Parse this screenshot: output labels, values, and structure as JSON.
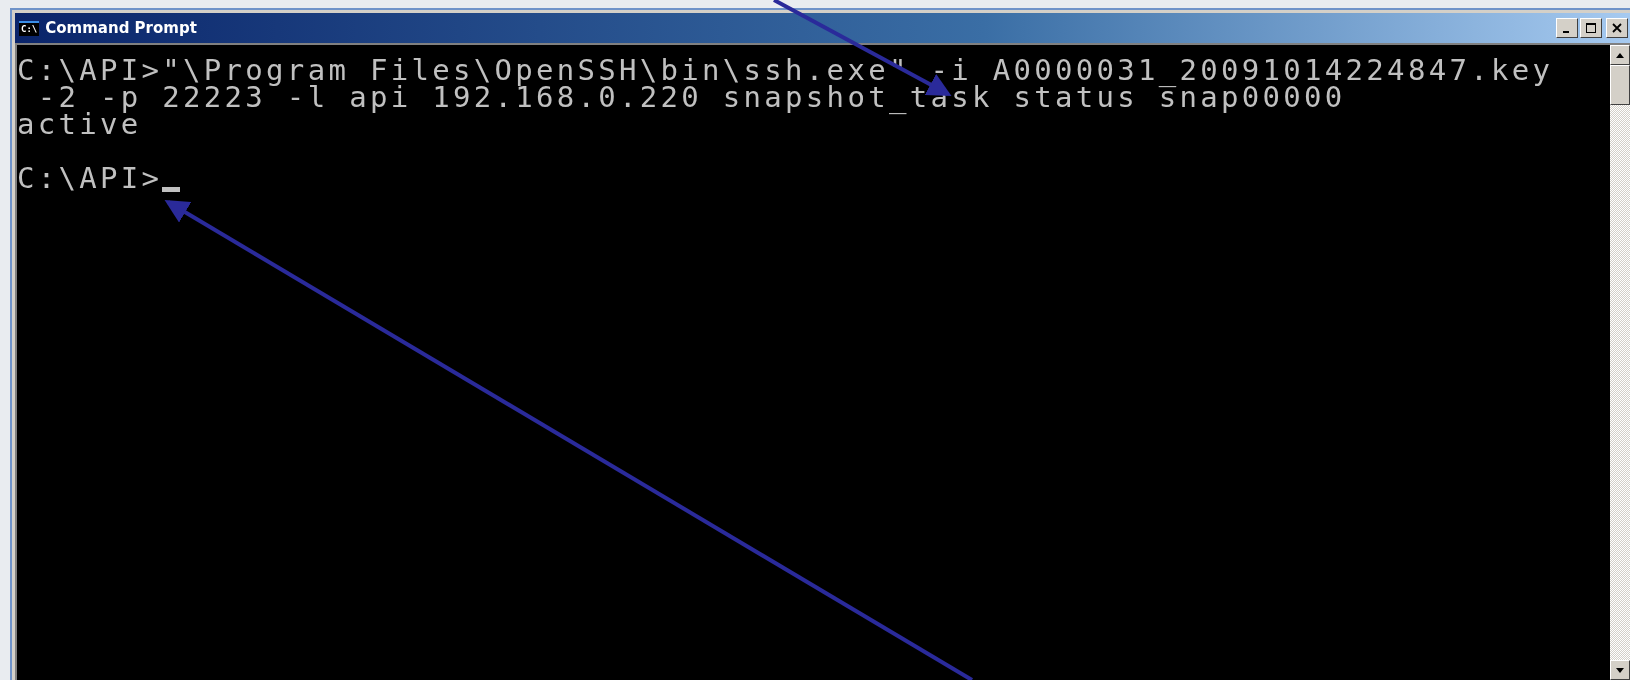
{
  "window": {
    "title": "Command Prompt",
    "icon_text": "C:\\"
  },
  "console": {
    "lines": [
      {
        "kind": "text",
        "text": "C:\\API>\"\\Program Files\\OpenSSH\\bin\\ssh.exe\" -i A0000031_20091014224847.key"
      },
      {
        "kind": "text",
        "text": " -2 -p 22223 -l api 192.168.0.220 snapshot_task status snap00000"
      },
      {
        "kind": "text",
        "text": "active"
      },
      {
        "kind": "blank"
      },
      {
        "kind": "text",
        "text": "C:\\API>"
      }
    ],
    "cursor_visible": true
  },
  "annotations": [
    {
      "kind": "arrow"
    },
    {
      "kind": "arrow"
    }
  ]
}
